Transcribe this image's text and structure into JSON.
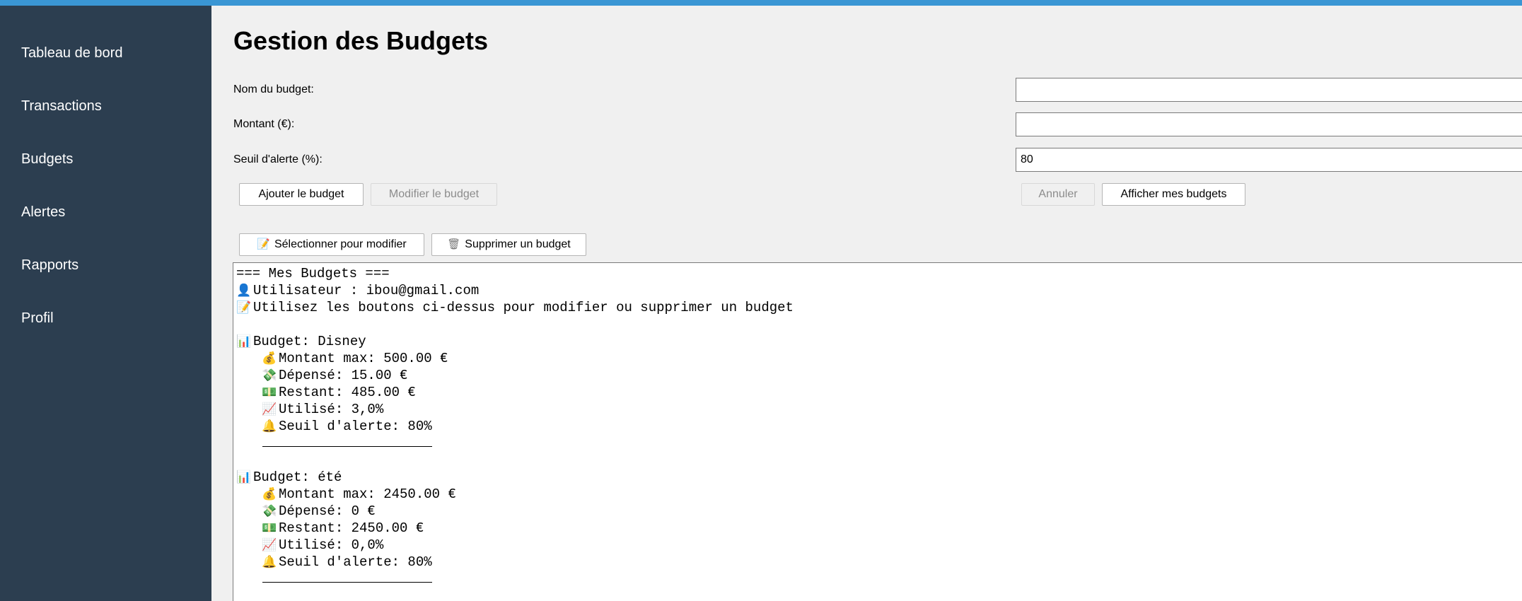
{
  "colors": {
    "topbar": "#3a96d4",
    "sidebar_bg": "#2c3e50",
    "sidebar_text": "#ffffff",
    "main_bg": "#f0f0f0"
  },
  "sidebar": {
    "items": [
      {
        "label": "Tableau de bord"
      },
      {
        "label": "Transactions"
      },
      {
        "label": "Budgets"
      },
      {
        "label": "Alertes"
      },
      {
        "label": "Rapports"
      },
      {
        "label": "Profil"
      }
    ]
  },
  "main": {
    "title": "Gestion des Budgets",
    "form": {
      "name_label": "Nom du budget:",
      "name_value": "",
      "amount_label": "Montant (€):",
      "amount_value": "",
      "threshold_label": "Seuil d'alerte (%):",
      "threshold_value": "80"
    },
    "buttons": {
      "add": "Ajouter le budget",
      "modify": "Modifier le budget",
      "cancel": "Annuler",
      "show": "Afficher mes budgets",
      "select_to_modify": "Sélectionner pour modifier",
      "select_icon": "memo-icon",
      "delete": "Supprimer un budget",
      "delete_icon": "trash-icon"
    },
    "output": {
      "header": "=== Mes Budgets ===",
      "user_line": "Utilisateur : ibou@gmail.com",
      "hint_line": "Utilisez les boutons ci-dessus pour modifier ou supprimer un budget",
      "budgets": [
        {
          "title": "Budget: Disney",
          "max": "Montant max: 500.00 €",
          "spent": "Dépensé: 15.00 €",
          "remaining": "Restant: 485.00 €",
          "used": "Utilisé: 3,0%",
          "threshold": "Seuil d'alerte: 80%"
        },
        {
          "title": "Budget: été",
          "max": "Montant max: 2450.00 €",
          "spent": "Dépensé: 0 €",
          "remaining": "Restant: 2450.00 €",
          "used": "Utilisé: 0,0%",
          "threshold": "Seuil d'alerte: 80%"
        }
      ]
    }
  }
}
